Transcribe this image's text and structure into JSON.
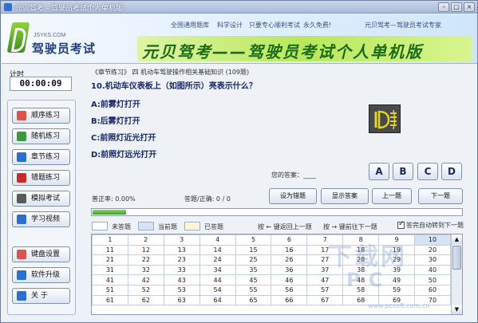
{
  "window": {
    "title": "元贝驾考 - 驾驶员考试个人单机版"
  },
  "banner": {
    "logo_small": "JSYKS.COM",
    "logo_title": "驾驶员考试",
    "slogans": [
      "全国通用题库",
      "科学设计",
      "只要专心",
      "顺利考试",
      "永久免费!"
    ],
    "right_slogan": "元贝驾考—驾驶员考试专家",
    "big_title": "元贝驾考——驾驶员考试个人单机版"
  },
  "timer": {
    "label": "计时",
    "value": "00:00:09"
  },
  "sidebar": {
    "items": [
      {
        "label": "顺序练习",
        "icon": "pencil-icon",
        "color": "#d9534f"
      },
      {
        "label": "随机练习",
        "icon": "shuffle-icon",
        "color": "#3c9a3c"
      },
      {
        "label": "章节练习",
        "icon": "book-icon",
        "color": "#2b6fd1"
      },
      {
        "label": "错题练习",
        "icon": "flag-icon",
        "color": "#cc2b2b"
      },
      {
        "label": "模拟考试",
        "icon": "exam-icon",
        "color": "#5a5a5a"
      },
      {
        "label": "学习视频",
        "icon": "video-icon",
        "color": "#2b6fd1"
      },
      {
        "label": "键盘设置",
        "icon": "keyboard-icon",
        "color": "#d9534f"
      },
      {
        "label": "软件升级",
        "icon": "upgrade-icon",
        "color": "#2b6fd1"
      },
      {
        "label": "关    于",
        "icon": "info-icon",
        "color": "#2b6fd1"
      }
    ]
  },
  "question": {
    "header": "《章节练习》  四  机动车驾驶操作相关基础知识 (109题)",
    "title": "10.机动车仪表板上（如图所示）亮表示什么？",
    "options": [
      "A:前雾灯打开",
      "B:后雾灯打开",
      "C:前照灯近光打开",
      "D:前照灯远光打开"
    ],
    "your_answer_label": "您的答案：____"
  },
  "answer_buttons": [
    "A",
    "B",
    "C",
    "D"
  ],
  "stats": {
    "accuracy": "普正率: 0.00%",
    "answered": "答题/正确: 0 / 0"
  },
  "actions": {
    "mark_wrong": "设为错题",
    "show_answer": "显示答案",
    "prev": "上一题",
    "next": "下一题"
  },
  "progress": {
    "value": 0.09
  },
  "legend": {
    "unanswered": "未答题",
    "current": "当前题",
    "answered": "已答题",
    "hint_prev": "按 ← 键返回上一题",
    "hint_next": "按 → 键前往下一题",
    "autojump": "答完自动转到下一题"
  },
  "colors": {
    "unanswered": "#ffffff",
    "current": "#d7e3f5",
    "answered": "#fdf6d6",
    "accent": "#1f3e84"
  },
  "grid": {
    "current": "10",
    "rows": [
      [
        "1",
        "2",
        "3",
        "4",
        "5",
        "6",
        "7",
        "8",
        "9",
        "10"
      ],
      [
        "11",
        "12",
        "13",
        "14",
        "15",
        "16",
        "17",
        "18",
        "19",
        "20"
      ],
      [
        "21",
        "22",
        "23",
        "24",
        "25",
        "26",
        "27",
        "28",
        "29",
        "30"
      ],
      [
        "31",
        "32",
        "33",
        "34",
        "35",
        "36",
        "37",
        "38",
        "39",
        "40"
      ],
      [
        "41",
        "42",
        "43",
        "44",
        "45",
        "46",
        "47",
        "48",
        "49",
        "50"
      ],
      [
        "51",
        "52",
        "53",
        "54",
        "55",
        "56",
        "57",
        "58",
        "59",
        "60"
      ],
      [
        "61",
        "62",
        "63",
        "64",
        "65",
        "66",
        "67",
        "68",
        "69",
        "70"
      ]
    ]
  },
  "watermark": {
    "line1": "下载网",
    "line2": "PC",
    "line3": "www.pcsoft.com.cn"
  }
}
